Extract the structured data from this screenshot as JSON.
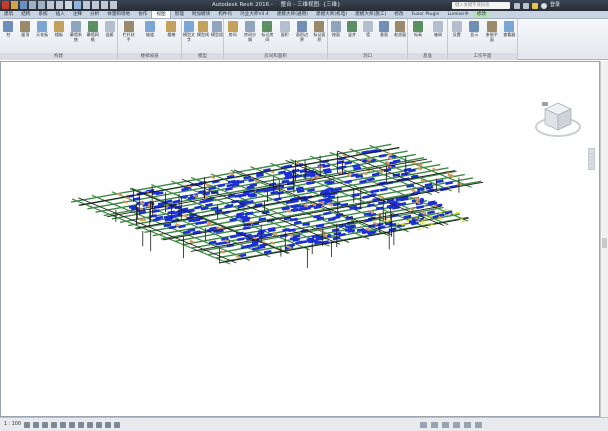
{
  "titlebar": {
    "app_title": "Autodesk Revit 2016 -",
    "document": "整合 - 三维视图: {三维}",
    "search_placeholder": "键入关键字或短语",
    "login": "登录"
  },
  "tabs": [
    {
      "label": "建筑",
      "active": false
    },
    {
      "label": "结构",
      "active": false
    },
    {
      "label": "系统",
      "active": false
    },
    {
      "label": "插入",
      "active": false
    },
    {
      "label": "注释",
      "active": false
    },
    {
      "label": "分析",
      "active": false
    },
    {
      "label": "体量和场地",
      "active": false
    },
    {
      "label": "协作",
      "active": false
    },
    {
      "label": "视图",
      "active": true
    },
    {
      "label": "管理",
      "active": false
    },
    {
      "label": "附加模块",
      "active": false
    },
    {
      "label": "构件坞",
      "active": false
    },
    {
      "label": "鸿业大师V4.4",
      "active": false
    },
    {
      "label": "建模大师(通用)",
      "active": false
    },
    {
      "label": "建模大师(机电)",
      "active": false
    },
    {
      "label": "建模大师(施工)",
      "active": false
    },
    {
      "label": "修改",
      "active": false
    },
    {
      "label": "Fuzor Plugin",
      "active": false
    },
    {
      "label": "Lumion®",
      "active": false
    },
    {
      "label": "修改",
      "active": false,
      "contextual": true
    }
  ],
  "ribbon": {
    "panels": [
      {
        "title": "构建",
        "buttons": [
          "柱",
          "屋顶",
          "天花板",
          "楼板",
          "幕墙系统",
          "幕墙网格",
          "竖梃"
        ]
      },
      {
        "title": "楼梯坡道",
        "buttons": [
          "栏杆扶手",
          "坡道",
          "楼梯"
        ]
      },
      {
        "title": "模型",
        "buttons": [
          "模型文字",
          "模型线",
          "模型组"
        ]
      },
      {
        "title": "房间和面积",
        "buttons": [
          "房间",
          "房间分隔",
          "标记房间",
          "面积",
          "面积边界",
          "标记面积"
        ]
      },
      {
        "title": "洞口",
        "buttons": [
          "按面",
          "竖井",
          "墙",
          "垂直",
          "老虎窗"
        ]
      },
      {
        "title": "基准",
        "buttons": [
          "标高",
          "轴网"
        ]
      },
      {
        "title": "工作平面",
        "buttons": [
          "设置",
          "显示",
          "参照平面",
          "查看器"
        ]
      }
    ]
  },
  "statusbar": {
    "scale": "1 : 100"
  },
  "colors": {
    "pipe_green": "#3f8a45",
    "duct_blue": "#1c2fd6",
    "tray_orange": "#d99862",
    "steel_black": "#1a1a1a",
    "yellow": "#e0d400"
  },
  "icons": [
    "viewcube-icon",
    "steering-wheel-icon",
    "zoom-icon",
    "pan-icon"
  ]
}
